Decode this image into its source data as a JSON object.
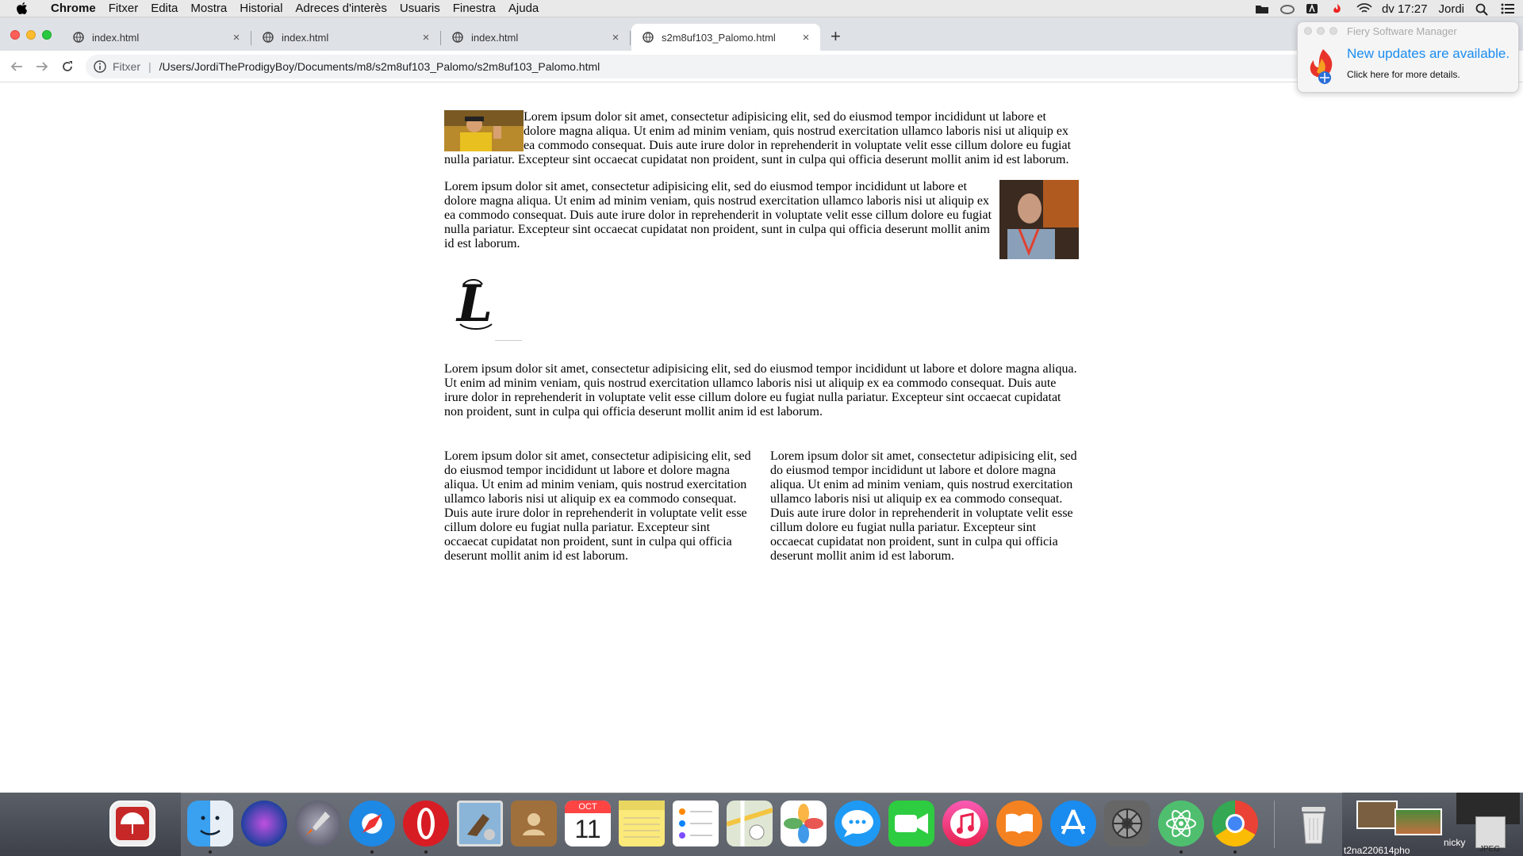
{
  "menubar": {
    "apple_glyph": "",
    "items": [
      "Chrome",
      "Fitxer",
      "Edita",
      "Mostra",
      "Historial",
      "Adreces d'interès",
      "Usuaris",
      "Finestra",
      "Ajuda"
    ],
    "clock": "dv 17:27",
    "user": "Jordi"
  },
  "browser": {
    "tabs": [
      {
        "title": "index.html"
      },
      {
        "title": "index.html"
      },
      {
        "title": "index.html"
      },
      {
        "title": "s2m8uf103_Palomo.html"
      }
    ],
    "close_glyph": "×",
    "newtab_glyph": "+",
    "omnibox": {
      "scheme_label": "Fitxer",
      "separator": "|",
      "url": "/Users/JordiTheProdigyBoy/Documents/m8/s2m8uf103_Palomo/s2m8uf103_Palomo.html"
    }
  },
  "page": {
    "p1": "Lorem ipsum dolor sit amet, consectetur adipisicing elit, sed do eiusmod tempor incididunt ut labore et dolore magna aliqua. Ut enim ad minim veniam, quis nostrud exercitation ullamco laboris nisi ut aliquip ex ea commodo consequat. Duis aute irure dolor in reprehenderit in voluptate velit esse cillum dolore eu fugiat nulla pariatur. Excepteur sint occaecat cupidatat non proident, sunt in culpa qui officia deserunt mollit anim id est laborum.",
    "p2": "Lorem ipsum dolor sit amet, consectetur adipisicing elit, sed do eiusmod tempor incididunt ut labore et dolore magna aliqua. Ut enim ad minim veniam, quis nostrud exercitation ullamco laboris nisi ut aliquip ex ea commodo consequat. Duis aute irure dolor in reprehenderit in voluptate velit esse cillum dolore eu fugiat nulla pariatur. Excepteur sint occaecat cupidatat non proident, sunt in culpa qui officia deserunt mollit anim id est laborum.",
    "p3": "Lorem ipsum dolor sit amet, consectetur adipisicing elit, sed do eiusmod tempor incididunt ut labore et dolore magna aliqua. Ut enim ad minim veniam, quis nostrud exercitation ullamco laboris nisi ut aliquip ex ea commodo consequat. Duis aute irure dolor in reprehenderit in voluptate velit esse cillum dolore eu fugiat nulla pariatur. Excepteur sint occaecat cupidatat non proident, sunt in culpa qui officia deserunt mollit anim id est laborum.",
    "col_left": "Lorem ipsum dolor sit amet, consectetur adipisicing elit, sed do eiusmod tempor incididunt ut labore et dolore magna aliqua. Ut enim ad minim veniam, quis nostrud exercitation ullamco laboris nisi ut aliquip ex ea commodo consequat. Duis aute irure dolor in reprehenderit in voluptate velit esse cillum dolore eu fugiat nulla pariatur. Excepteur sint occaecat cupidatat non proident, sunt in culpa qui officia deserunt mollit anim id est laborum.",
    "col_right": "Lorem ipsum dolor sit amet, consectetur adipisicing elit, sed do eiusmod tempor incididunt ut labore et dolore magna aliqua. Ut enim ad minim veniam, quis nostrud exercitation ullamco laboris nisi ut aliquip ex ea commodo consequat. Duis aute irure dolor in reprehenderit in voluptate velit esse cillum dolore eu fugiat nulla pariatur. Excepteur sint occaecat cupidatat non proident, sunt in culpa qui officia deserunt mollit anim id est laborum.",
    "logo_glyph": "L"
  },
  "notification": {
    "app": "Fiery Software Manager",
    "headline": "New updates are available.",
    "detail": "Click here for more details."
  },
  "dock": {
    "calendar_month": "OCT",
    "calendar_day": "11",
    "desktop_labels": [
      "t2na220614pho",
      "nicky",
      "JPEG"
    ]
  },
  "colors": {
    "accent_blue": "#1a8cf0",
    "chrome_tabstrip": "#dee1e6",
    "menubar": "#e9e9e9"
  }
}
